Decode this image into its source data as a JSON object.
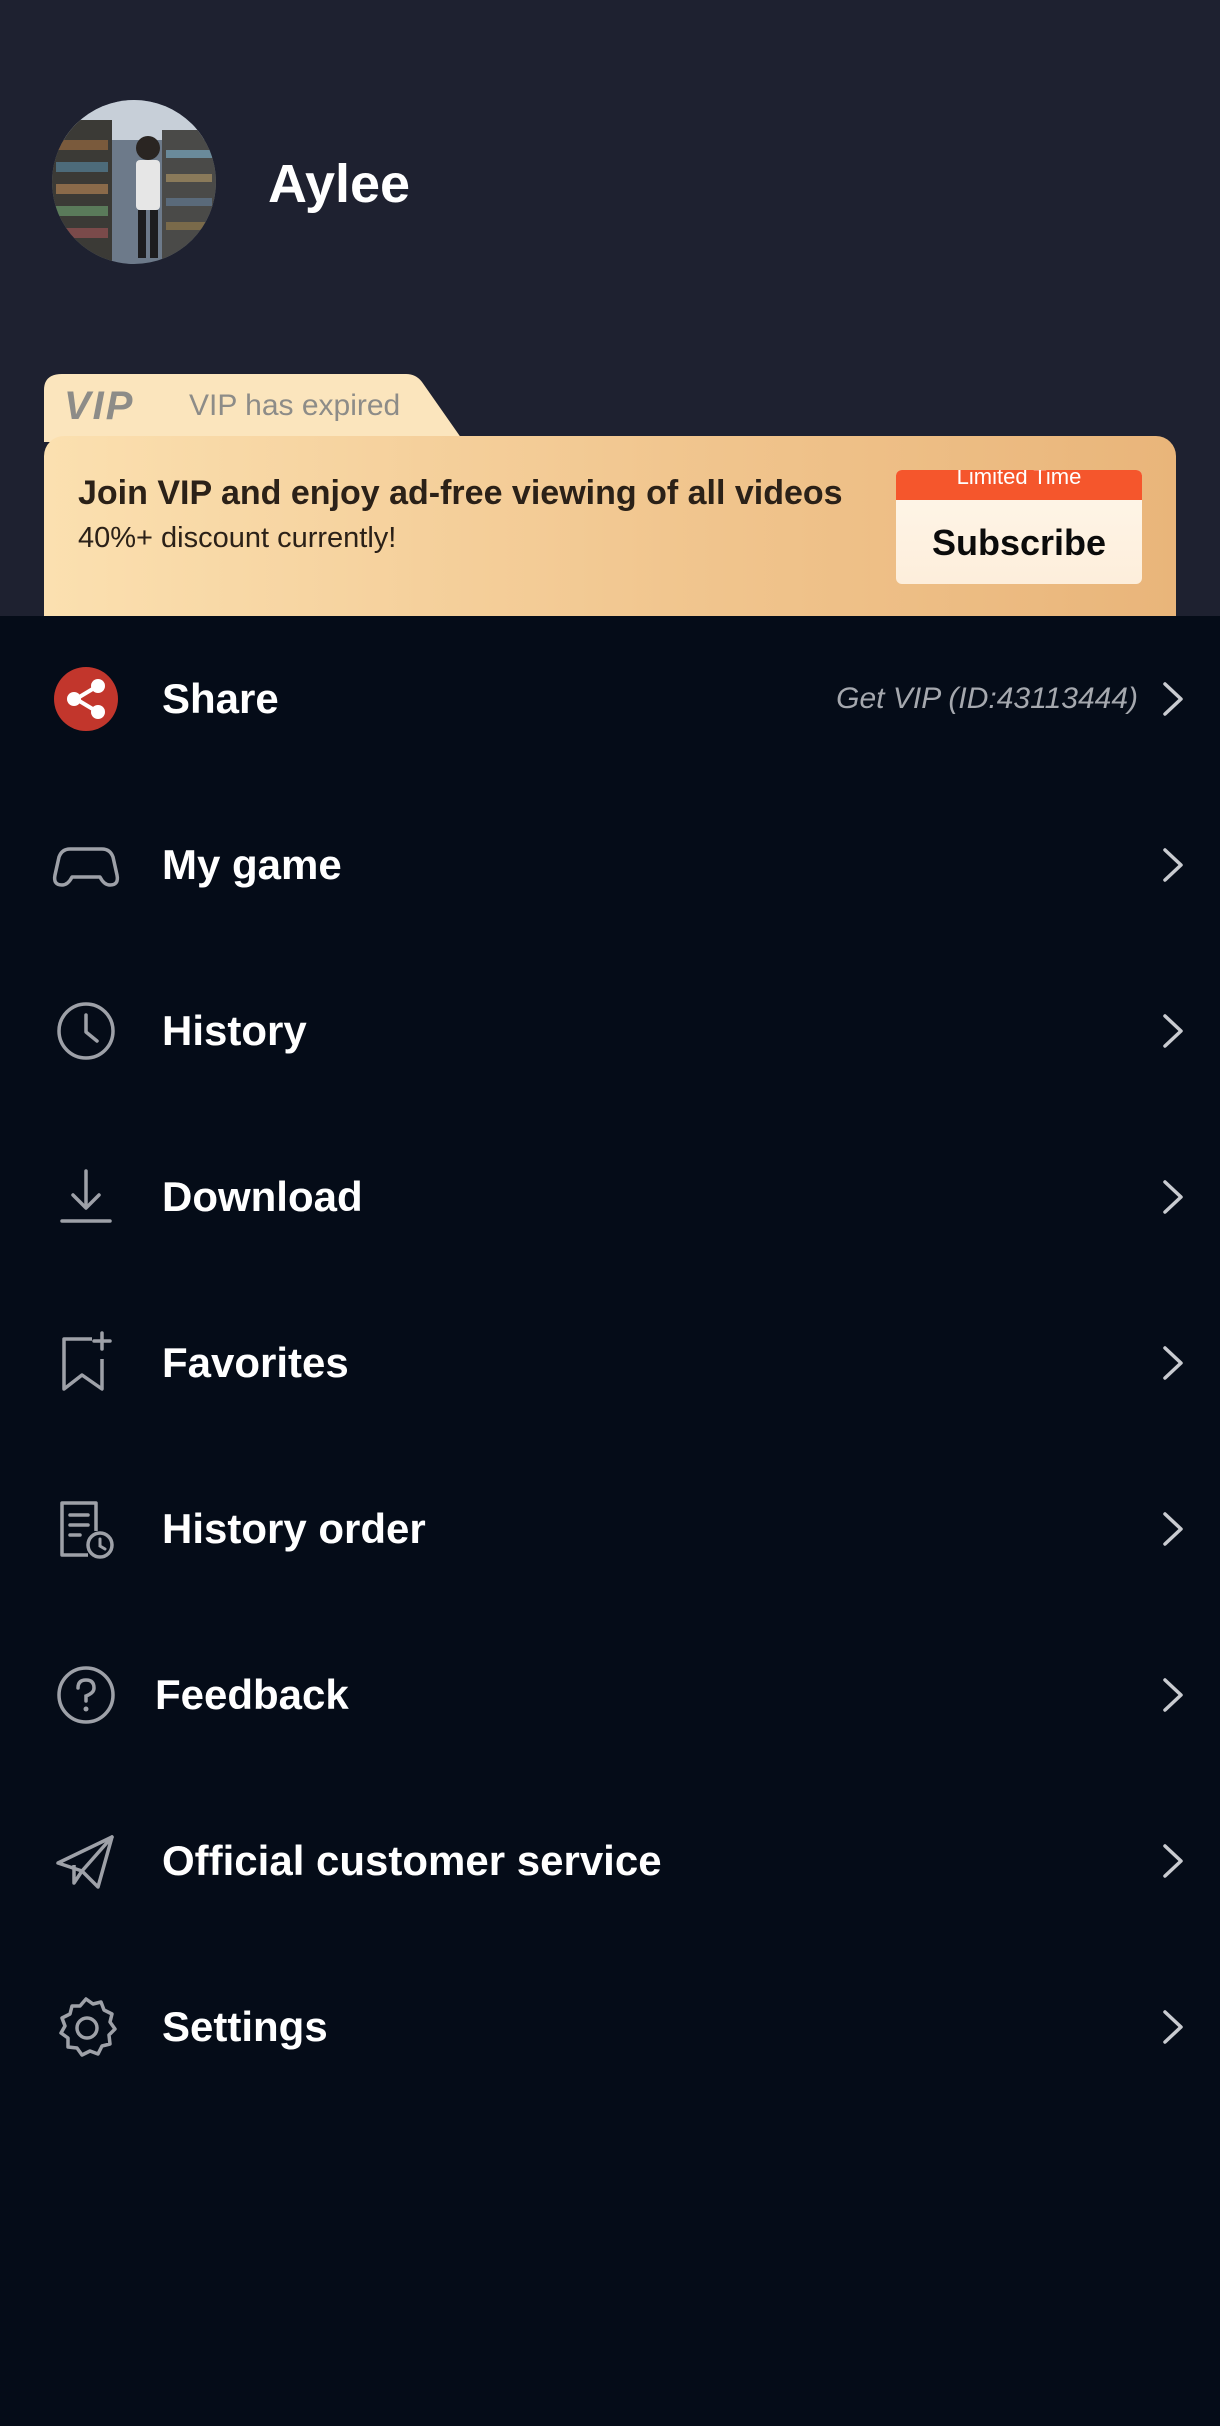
{
  "profile": {
    "username": "Aylee",
    "avatar_icon": "user-avatar-photo"
  },
  "vip": {
    "logo_text": "VIP",
    "status": "VIP has expired",
    "title": "Join VIP and enjoy ad-free viewing of all videos",
    "subtitle": "40%+ discount currently!",
    "badge": "Limited Time",
    "subscribe_label": "Subscribe"
  },
  "menu": {
    "items": [
      {
        "label": "Share",
        "icon": "share-icon",
        "extra": "Get VIP (ID:43113444)"
      },
      {
        "label": "My game",
        "icon": "gamepad-icon"
      },
      {
        "label": "History",
        "icon": "clock-icon"
      },
      {
        "label": "Download",
        "icon": "download-icon"
      },
      {
        "label": "Favorites",
        "icon": "bookmark-add-icon"
      },
      {
        "label": "History order",
        "icon": "order-history-icon"
      },
      {
        "label": "Feedback",
        "icon": "help-circle-icon"
      },
      {
        "label": "Official customer service",
        "icon": "paper-plane-icon"
      },
      {
        "label": "Settings",
        "icon": "gear-icon"
      }
    ]
  },
  "colors": {
    "header_bg": "#1e2130",
    "page_bg": "#050c18",
    "vip_gradient_start": "#fbe0b0",
    "vip_gradient_end": "#e9b57a",
    "badge": "#f5562c",
    "share_icon": "#c2362c"
  }
}
